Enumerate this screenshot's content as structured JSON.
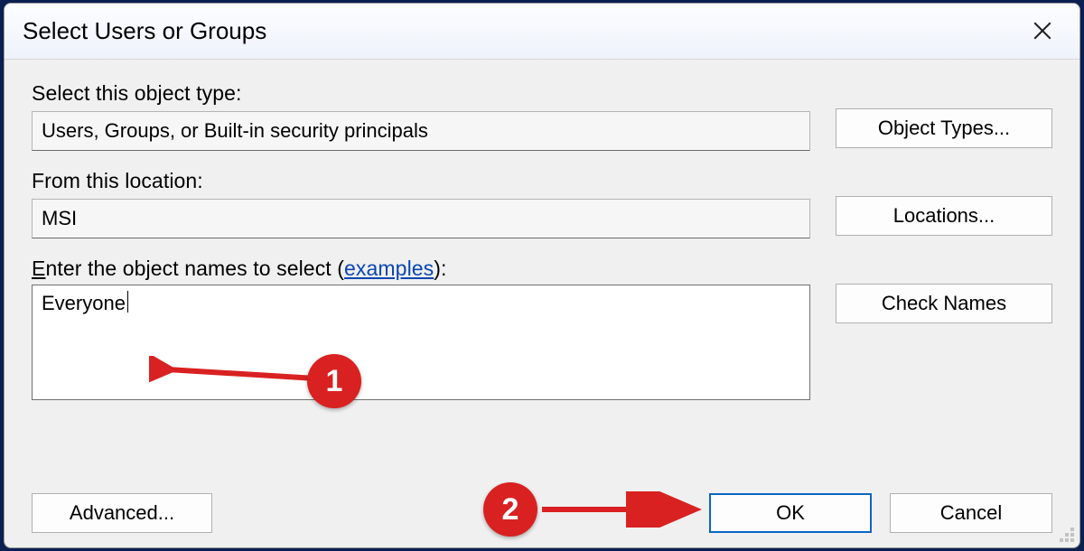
{
  "title": "Select Users or Groups",
  "close_tooltip": "Close",
  "object_type": {
    "label": "Select this object type:",
    "value": "Users, Groups, or Built-in security principals",
    "button": "Object Types..."
  },
  "location": {
    "label": "From this location:",
    "value": "MSI",
    "button": "Locations..."
  },
  "names": {
    "label_prefix_u": "E",
    "label_rest": "nter the object names to select (",
    "examples_link": "examples",
    "label_suffix": "):",
    "value": "Everyone",
    "check_button": "Check Names"
  },
  "footer": {
    "advanced": "Advanced...",
    "ok": "OK",
    "cancel": "Cancel"
  },
  "annotations": {
    "step1": "1",
    "step2": "2"
  }
}
